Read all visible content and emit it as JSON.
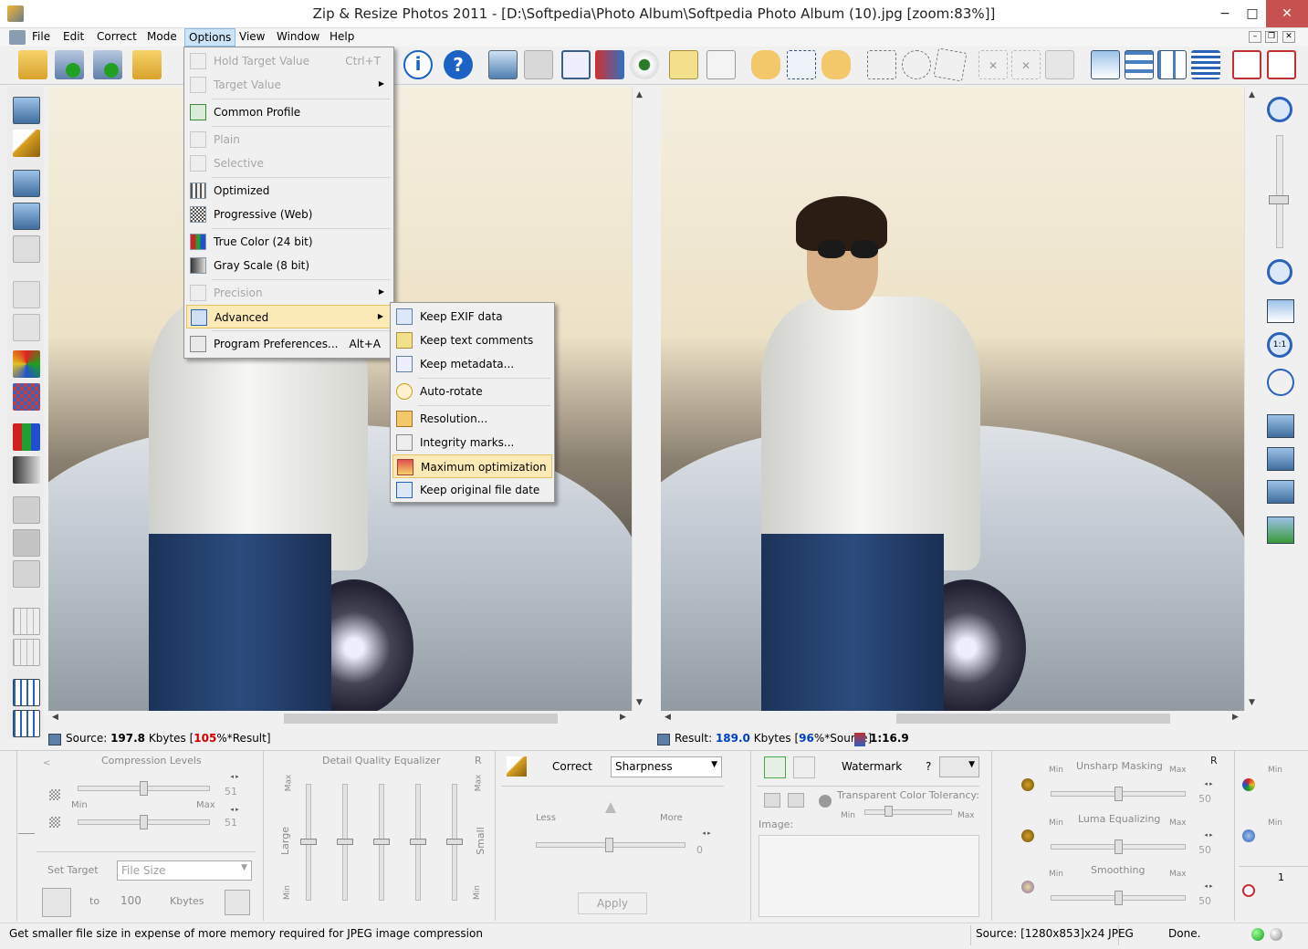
{
  "window": {
    "title": "Zip & Resize Photos 2011 - [D:\\Softpedia\\Photo Album\\Softpedia Photo Album (10).jpg  [zoom:83%]]",
    "minimize": "−",
    "maximize": "□",
    "close": "✕"
  },
  "menubar": {
    "items": [
      "File",
      "Edit",
      "Correct",
      "Mode",
      "Options",
      "View",
      "Window",
      "Help"
    ]
  },
  "options_menu": {
    "items": [
      {
        "label": "Hold Target Value",
        "shortcut": "Ctrl+T",
        "disabled": true
      },
      {
        "label": "Target Value",
        "submenu": true,
        "disabled": true
      },
      {
        "label": "Common Profile"
      },
      {
        "label": "Plain",
        "disabled": true
      },
      {
        "label": "Selective",
        "disabled": true
      },
      {
        "label": "Optimized"
      },
      {
        "label": "Progressive (Web)"
      },
      {
        "label": "True Color (24 bit)"
      },
      {
        "label": "Gray Scale (8 bit)"
      },
      {
        "label": "Precision",
        "submenu": true,
        "disabled": true
      },
      {
        "label": "Advanced",
        "submenu": true,
        "highlighted": true
      },
      {
        "label": "Program Preferences...",
        "shortcut": "Alt+A"
      }
    ]
  },
  "advanced_submenu": {
    "items": [
      {
        "label": "Keep EXIF data"
      },
      {
        "label": "Keep text comments"
      },
      {
        "label": "Keep metadata..."
      },
      {
        "label": "Auto-rotate"
      },
      {
        "label": "Resolution..."
      },
      {
        "label": "Integrity marks..."
      },
      {
        "label": "Maximum optimization",
        "highlighted": true
      },
      {
        "label": "Keep original file date"
      }
    ]
  },
  "panes": {
    "source_prefix": "Source: ",
    "source_size": "197.8",
    "source_unit": " Kbytes  [",
    "source_pct": "105",
    "source_suffix": "%*Result]",
    "result_prefix": "Result: ",
    "result_size": "189.0",
    "result_unit": " Kbytes  [",
    "result_pct": "96",
    "result_suffix": "%*Source]",
    "ratio": "1:16.9"
  },
  "compression": {
    "title": "Compression Levels",
    "value1": "51",
    "value2": "51",
    "min": "Min",
    "max": "Max",
    "set_target_label": "Set Target",
    "set_target_value": "File Size",
    "to_label": "to",
    "to_value": "100",
    "unit": "Kbytes"
  },
  "equalizer": {
    "title": "Detail Quality Equalizer",
    "r": "R",
    "max": "Max",
    "min": "Min",
    "large": "Large",
    "small": "Small"
  },
  "correct": {
    "label": "Correct",
    "selected": "Sharpness",
    "less": "Less",
    "more": "More",
    "value": "0",
    "apply": "Apply"
  },
  "watermark": {
    "label": "Watermark",
    "q": "?",
    "tolerance": "Transparent Color Tolerancy:",
    "min": "Min",
    "max": "Max",
    "image": "Image:"
  },
  "filters": {
    "r": "R",
    "items": [
      {
        "name": "Unsharp Masking",
        "value": "50"
      },
      {
        "name": "Luma Equalizing",
        "value": "50"
      },
      {
        "name": "Smoothing",
        "value": "50"
      }
    ],
    "min": "Min",
    "max": "Max",
    "extra_value": "1"
  },
  "statusbar": {
    "hint": "Get smaller file size in expense of more memory required for JPEG image compression",
    "source_info": "Source: [1280x853]x24 JPEG",
    "state": "Done."
  },
  "colors": {
    "accent_red": "#cc0000",
    "accent_blue": "#0040c0",
    "highlight": "#fbeab5"
  }
}
